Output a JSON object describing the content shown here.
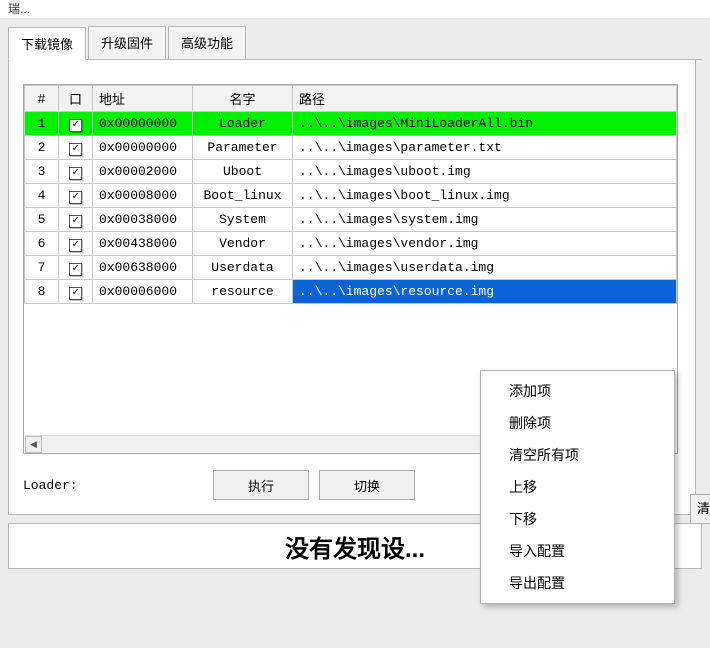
{
  "window": {
    "title_fragment": "瑞..."
  },
  "tabs": [
    {
      "label": "下载镜像",
      "active": true
    },
    {
      "label": "升级固件",
      "active": false
    },
    {
      "label": "高级功能",
      "active": false
    }
  ],
  "table": {
    "headers": {
      "idx": "#",
      "chk": "口",
      "addr": "地址",
      "name": "名字",
      "path": "路径"
    },
    "rows": [
      {
        "idx": "1",
        "checked": true,
        "addr": "0x00000000",
        "name": "Loader",
        "path": "..\\..\\images\\MiniLoaderAll.bin",
        "state": "green"
      },
      {
        "idx": "2",
        "checked": true,
        "addr": "0x00000000",
        "name": "Parameter",
        "path": "..\\..\\images\\parameter.txt",
        "state": ""
      },
      {
        "idx": "3",
        "checked": true,
        "addr": "0x00002000",
        "name": "Uboot",
        "path": "..\\..\\images\\uboot.img",
        "state": ""
      },
      {
        "idx": "4",
        "checked": true,
        "addr": "0x00008000",
        "name": "Boot_linux",
        "path": "..\\..\\images\\boot_linux.img",
        "state": ""
      },
      {
        "idx": "5",
        "checked": true,
        "addr": "0x00038000",
        "name": "System",
        "path": "..\\..\\images\\system.img",
        "state": ""
      },
      {
        "idx": "6",
        "checked": true,
        "addr": "0x00438000",
        "name": "Vendor",
        "path": "..\\..\\images\\vendor.img",
        "state": ""
      },
      {
        "idx": "7",
        "checked": true,
        "addr": "0x00638000",
        "name": "Userdata",
        "path": "..\\..\\images\\userdata.img",
        "state": ""
      },
      {
        "idx": "8",
        "checked": true,
        "addr": "0x00006000",
        "name": "resource",
        "path": "..\\..\\images\\resource.img",
        "state": "selected"
      }
    ]
  },
  "loader_label": "Loader:",
  "buttons": {
    "run": "执行",
    "switch": "切换",
    "clear_cut": "清空"
  },
  "context_menu": [
    "添加项",
    "删除项",
    "清空所有项",
    "上移",
    "下移",
    "导入配置",
    "导出配置"
  ],
  "status_text": "没有发现设..."
}
